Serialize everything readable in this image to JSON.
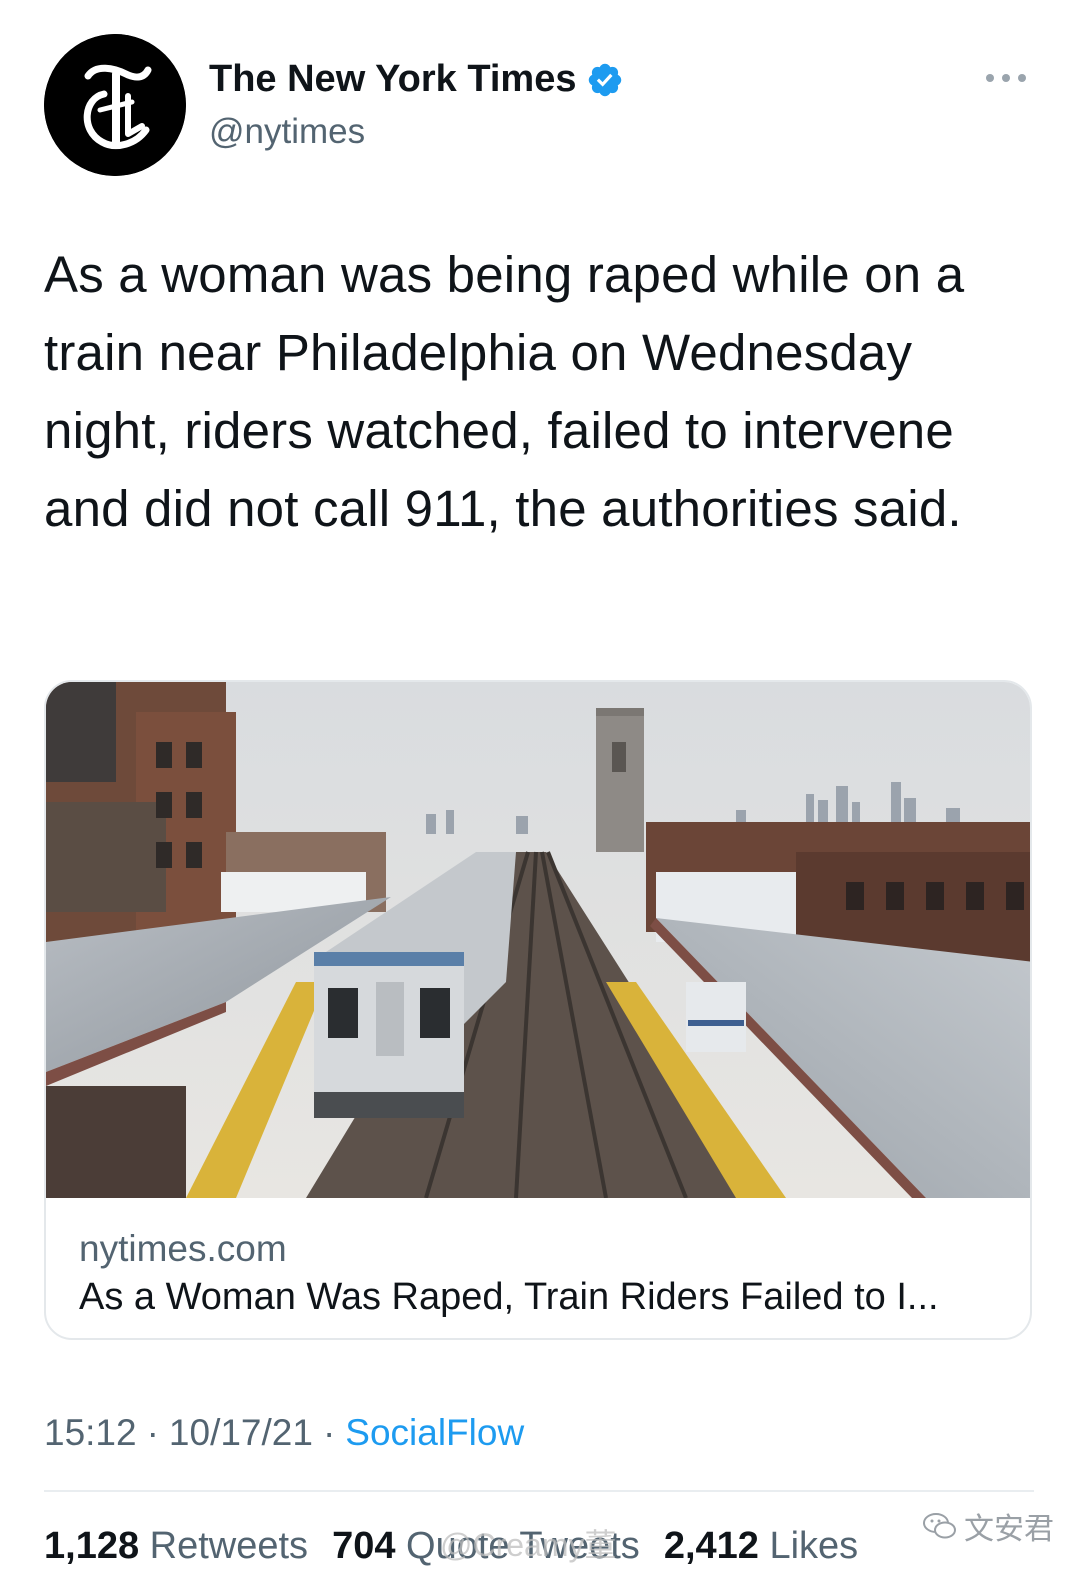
{
  "tweet": {
    "author": {
      "display_name": "The New York Times",
      "handle": "@nytimes",
      "verified": true,
      "avatar_icon": "nyt-logo-icon"
    },
    "text": "As a woman was being raped while on a train near Philadelphia on Wednesday night, riders watched, failed to intervene and did not call 911, the authorities said.",
    "card": {
      "image_icon": "train-station-photo",
      "domain": "nytimes.com",
      "title": "As a Woman Was Raped, Train Riders Failed to I..."
    },
    "meta": {
      "time": "15:12",
      "separator": "·",
      "date": "10/17/21",
      "source": "SocialFlow"
    },
    "stats": {
      "retweets_count": "1,128",
      "retweets_label": "Retweets",
      "quotes_count": "704",
      "quotes_label": "Quote Tweets",
      "likes_count": "2,412",
      "likes_label": "Likes"
    }
  },
  "watermarks": {
    "weibo": "@Creamy董",
    "wechat": "文安君"
  },
  "colors": {
    "text": "#0f1419",
    "secondary": "#536471",
    "link": "#1d9bf0",
    "border": "#e4e8eb"
  }
}
